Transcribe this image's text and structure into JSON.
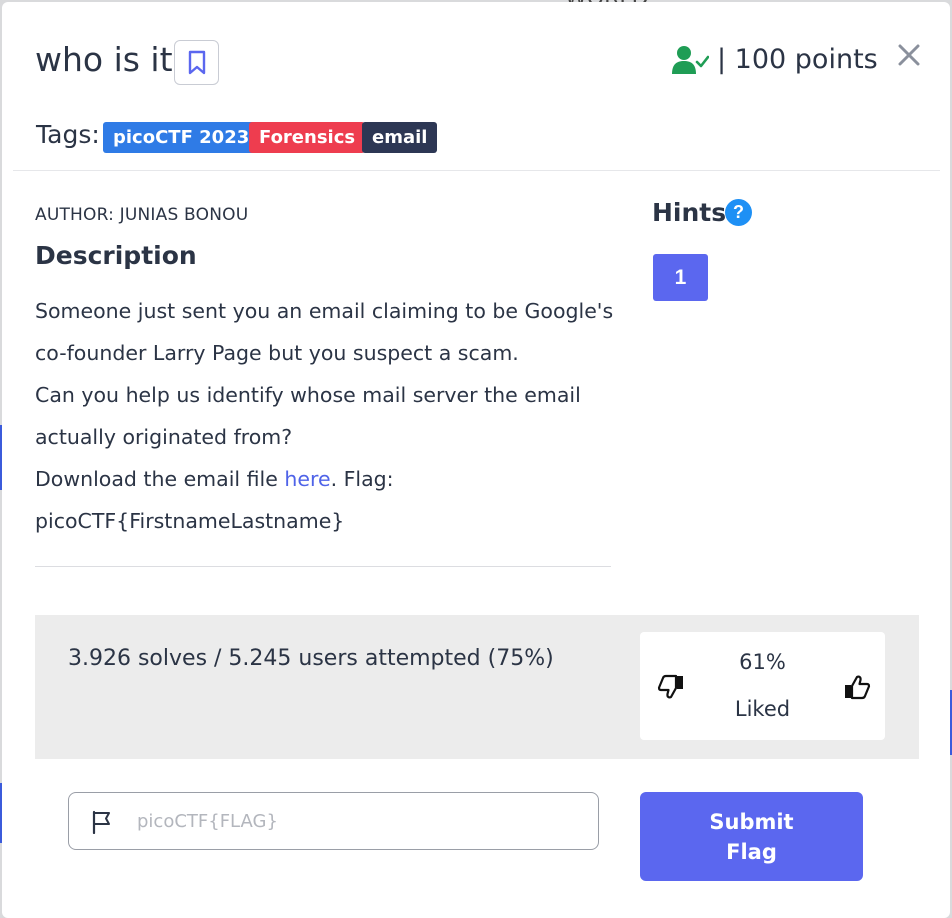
{
  "background": {
    "top_text": "WORLD"
  },
  "challenge": {
    "title": "who is it",
    "points": "| 100 points",
    "tags_label": "Tags:",
    "tags": [
      "picoCTF 2023",
      "Forensics",
      "email"
    ],
    "author": "AUTHOR: JUNIAS BONOU",
    "description_heading": "Description",
    "description": {
      "line1": "Someone just sent you an email claiming to be Google's co-founder Larry Page but you suspect a scam.",
      "line2": "Can you help us identify whose mail server the email actually originated from?",
      "line3_prefix": "Download the email file ",
      "link_text": "here",
      "line3_suffix": ". Flag: picoCTF{FirstnameLastname}"
    }
  },
  "hints": {
    "heading": "Hints",
    "help_glyph": "?",
    "items": [
      "1"
    ]
  },
  "stats": {
    "solves_text": "3.926 solves / 5.245 users attempted (75%)",
    "liked_percent": "61%",
    "liked_label": "Liked"
  },
  "flag_form": {
    "placeholder": "picoCTF{FLAG}",
    "value": "",
    "submit_label": "Submit Flag"
  },
  "colors": {
    "accent": "#5b67ef",
    "tag_event": "#2f7be6",
    "tag_category": "#ee3d4f",
    "tag_topic": "#2d3754",
    "solved_green": "#1f9d55",
    "help_blue": "#1e90f5"
  },
  "icons": {
    "bookmark": "bookmark-icon",
    "solved": "user-check-icon",
    "close": "close-icon",
    "thumb_down": "thumbs-down-icon",
    "thumb_up": "thumbs-up-icon",
    "flag": "flag-icon"
  }
}
